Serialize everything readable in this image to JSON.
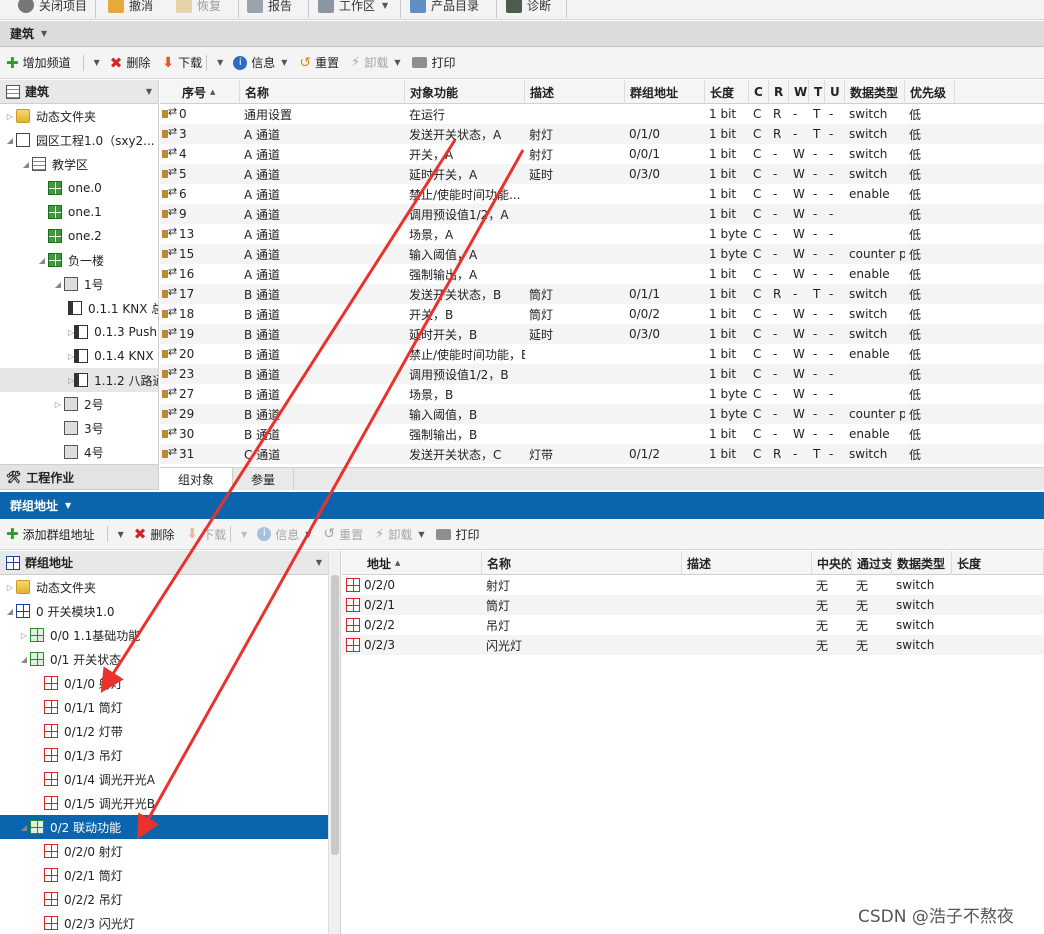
{
  "top_toolbar": {
    "items": [
      {
        "label": "关闭项目",
        "icon": "close-project-icon"
      },
      {
        "label": "撤消",
        "icon": "undo-icon"
      },
      {
        "label": "恢复",
        "icon": "redo-icon"
      },
      {
        "label": "报告",
        "icon": "report-icon"
      },
      {
        "label": "工作区",
        "icon": "workspace-icon"
      },
      {
        "label": "产品目录",
        "icon": "catalog-icon"
      },
      {
        "label": "诊断",
        "icon": "diagnostics-icon"
      }
    ]
  },
  "building_panel": {
    "title": "建筑",
    "toolbar": {
      "add_channel": "增加频道",
      "delete": "删除",
      "download": "下载",
      "info": "信息",
      "reset": "重置",
      "unload": "卸载",
      "print": "打印"
    },
    "tree_header": "建筑",
    "tree": [
      {
        "label": "动态文件夹",
        "icon": "folder-icon",
        "level": 0,
        "caret": "▷"
      },
      {
        "label": "园区工程1.0（sxy2...",
        "icon": "project-icon",
        "level": 0,
        "caret": "◢"
      },
      {
        "label": "教学区",
        "icon": "building-icon",
        "level": 1,
        "caret": "◢"
      },
      {
        "label": "one.0",
        "icon": "room-icon",
        "level": 2,
        "caret": ""
      },
      {
        "label": "one.1",
        "icon": "room-icon",
        "level": 2,
        "caret": ""
      },
      {
        "label": "one.2",
        "icon": "room-icon",
        "level": 2,
        "caret": ""
      },
      {
        "label": "负一楼",
        "icon": "room-icon",
        "level": 2,
        "caret": "◢"
      },
      {
        "label": "1号",
        "icon": "cabinet-icon",
        "level": 3,
        "caret": "◢"
      },
      {
        "label": "0.1.1 KNX 总...",
        "icon": "device-icon",
        "level": 4,
        "caret": ""
      },
      {
        "label": "0.1.3 Push bu...",
        "icon": "device-icon",
        "level": 4,
        "caret": "▷"
      },
      {
        "label": "0.1.4 KNX Sm...",
        "icon": "device-icon",
        "level": 4,
        "caret": "▷"
      },
      {
        "label": "1.1.2 八路通...",
        "icon": "device-icon",
        "level": 4,
        "caret": "▷",
        "highlight": true
      },
      {
        "label": "2号",
        "icon": "cabinet-icon",
        "level": 3,
        "caret": "▷"
      },
      {
        "label": "3号",
        "icon": "cabinet-icon",
        "level": 3,
        "caret": ""
      },
      {
        "label": "4号",
        "icon": "cabinet-icon",
        "level": 3,
        "caret": ""
      }
    ],
    "bottom_item": "工程作业",
    "table": {
      "columns": [
        "序号",
        "名称",
        "对象功能",
        "描述",
        "群组地址",
        "长度",
        "C",
        "R",
        "W",
        "T",
        "U",
        "数据类型",
        "优先级"
      ],
      "rows": [
        [
          "0",
          "通用设置",
          "在运行",
          "",
          "",
          "1 bit",
          "C",
          "R",
          "-",
          "T",
          "-",
          "switch",
          "低"
        ],
        [
          "3",
          "A 通道",
          "发送开关状态，A",
          "射灯",
          "0/1/0",
          "1 bit",
          "C",
          "R",
          "-",
          "T",
          "-",
          "switch",
          "低"
        ],
        [
          "4",
          "A 通道",
          "开关，A",
          "射灯",
          "0/0/1",
          "1 bit",
          "C",
          "-",
          "W",
          "-",
          "-",
          "switch",
          "低"
        ],
        [
          "5",
          "A 通道",
          "延时开关，A",
          "延时",
          "0/3/0",
          "1 bit",
          "C",
          "-",
          "W",
          "-",
          "-",
          "switch",
          "低"
        ],
        [
          "6",
          "A 通道",
          "禁止/使能时间功能...",
          "",
          "",
          "1 bit",
          "C",
          "-",
          "W",
          "-",
          "-",
          "enable",
          "低"
        ],
        [
          "9",
          "A 通道",
          "调用预设值1/2，A",
          "",
          "",
          "1 bit",
          "C",
          "-",
          "W",
          "-",
          "-",
          "",
          "低"
        ],
        [
          "13",
          "A 通道",
          "场景，A",
          "",
          "",
          "1 byte",
          "C",
          "-",
          "W",
          "-",
          "-",
          "",
          "低"
        ],
        [
          "15",
          "A 通道",
          "输入阈值，A",
          "",
          "",
          "1 byte",
          "C",
          "-",
          "W",
          "-",
          "-",
          "counter p...",
          "低"
        ],
        [
          "16",
          "A 通道",
          "强制输出，A",
          "",
          "",
          "1 bit",
          "C",
          "-",
          "W",
          "-",
          "-",
          "enable",
          "低"
        ],
        [
          "17",
          "B 通道",
          "发送开关状态，B",
          "筒灯",
          "0/1/1",
          "1 bit",
          "C",
          "R",
          "-",
          "T",
          "-",
          "switch",
          "低"
        ],
        [
          "18",
          "B 通道",
          "开关，B",
          "筒灯",
          "0/0/2",
          "1 bit",
          "C",
          "-",
          "W",
          "-",
          "-",
          "switch",
          "低"
        ],
        [
          "19",
          "B 通道",
          "延时开关，B",
          "延时",
          "0/3/0",
          "1 bit",
          "C",
          "-",
          "W",
          "-",
          "-",
          "switch",
          "低"
        ],
        [
          "20",
          "B 通道",
          "禁止/使能时间功能，B",
          "",
          "",
          "1 bit",
          "C",
          "-",
          "W",
          "-",
          "-",
          "enable",
          "低"
        ],
        [
          "23",
          "B 通道",
          "调用预设值1/2，B",
          "",
          "",
          "1 bit",
          "C",
          "-",
          "W",
          "-",
          "-",
          "",
          "低"
        ],
        [
          "27",
          "B 通道",
          "场景，B",
          "",
          "",
          "1 byte",
          "C",
          "-",
          "W",
          "-",
          "-",
          "",
          "低"
        ],
        [
          "29",
          "B 通道",
          "输入阈值，B",
          "",
          "",
          "1 byte",
          "C",
          "-",
          "W",
          "-",
          "-",
          "counter p...",
          "低"
        ],
        [
          "30",
          "B 通道",
          "强制输出，B",
          "",
          "",
          "1 bit",
          "C",
          "-",
          "W",
          "-",
          "-",
          "enable",
          "低"
        ],
        [
          "31",
          "C 通道",
          "发送开关状态，C",
          "灯带",
          "0/1/2",
          "1 bit",
          "C",
          "R",
          "-",
          "T",
          "-",
          "switch",
          "低"
        ]
      ]
    },
    "tabs": [
      "组对象",
      "参量"
    ]
  },
  "group_panel": {
    "title": "群组地址",
    "toolbar": {
      "add_group": "添加群组地址",
      "delete": "删除",
      "download": "下载",
      "info": "信息",
      "reset": "重置",
      "unload": "卸载",
      "print": "打印"
    },
    "tree_header": "群组地址",
    "tree": [
      {
        "label": "动态文件夹",
        "icon": "folder-icon",
        "level": 0,
        "caret": "▷"
      },
      {
        "label": "0 开关模块1.0",
        "icon": "main-group-icon",
        "level": 0,
        "caret": "◢"
      },
      {
        "label": "0/0 1.1基础功能",
        "icon": "middle-group-icon",
        "level": 1,
        "caret": "▷"
      },
      {
        "label": "0/1 开关状态",
        "icon": "middle-group-icon",
        "level": 1,
        "caret": "◢"
      },
      {
        "label": "0/1/0 射灯",
        "icon": "group-address-icon",
        "level": 2,
        "caret": ""
      },
      {
        "label": "0/1/1 筒灯",
        "icon": "group-address-icon",
        "level": 2,
        "caret": ""
      },
      {
        "label": "0/1/2 灯带",
        "icon": "group-address-icon",
        "level": 2,
        "caret": ""
      },
      {
        "label": "0/1/3 吊灯",
        "icon": "group-address-icon",
        "level": 2,
        "caret": ""
      },
      {
        "label": "0/1/4 调光开光A",
        "icon": "group-address-icon",
        "level": 2,
        "caret": ""
      },
      {
        "label": "0/1/5 调光开光B",
        "icon": "group-address-icon",
        "level": 2,
        "caret": ""
      },
      {
        "label": "0/2 联动功能",
        "icon": "middle-group-icon",
        "level": 1,
        "caret": "◢",
        "selected": true
      },
      {
        "label": "0/2/0 射灯",
        "icon": "group-address-icon",
        "level": 2,
        "caret": ""
      },
      {
        "label": "0/2/1 筒灯",
        "icon": "group-address-icon",
        "level": 2,
        "caret": ""
      },
      {
        "label": "0/2/2 吊灯",
        "icon": "group-address-icon",
        "level": 2,
        "caret": ""
      },
      {
        "label": "0/2/3 闪光灯",
        "icon": "group-address-icon",
        "level": 2,
        "caret": ""
      }
    ],
    "table": {
      "columns": [
        "地址",
        "名称",
        "描述",
        "中央的",
        "通过支",
        "数据类型",
        "长度"
      ],
      "rows": [
        [
          "0/2/0",
          "射灯",
          "",
          "无",
          "无",
          "switch",
          ""
        ],
        [
          "0/2/1",
          "筒灯",
          "",
          "无",
          "无",
          "switch",
          ""
        ],
        [
          "0/2/2",
          "吊灯",
          "",
          "无",
          "无",
          "switch",
          ""
        ],
        [
          "0/2/3",
          "闪光灯",
          "",
          "无",
          "无",
          "switch",
          ""
        ]
      ]
    }
  },
  "annotation_arrows": {
    "color": "#e8322b",
    "count": 2
  },
  "watermark": "CSDN @浩子不熬夜"
}
